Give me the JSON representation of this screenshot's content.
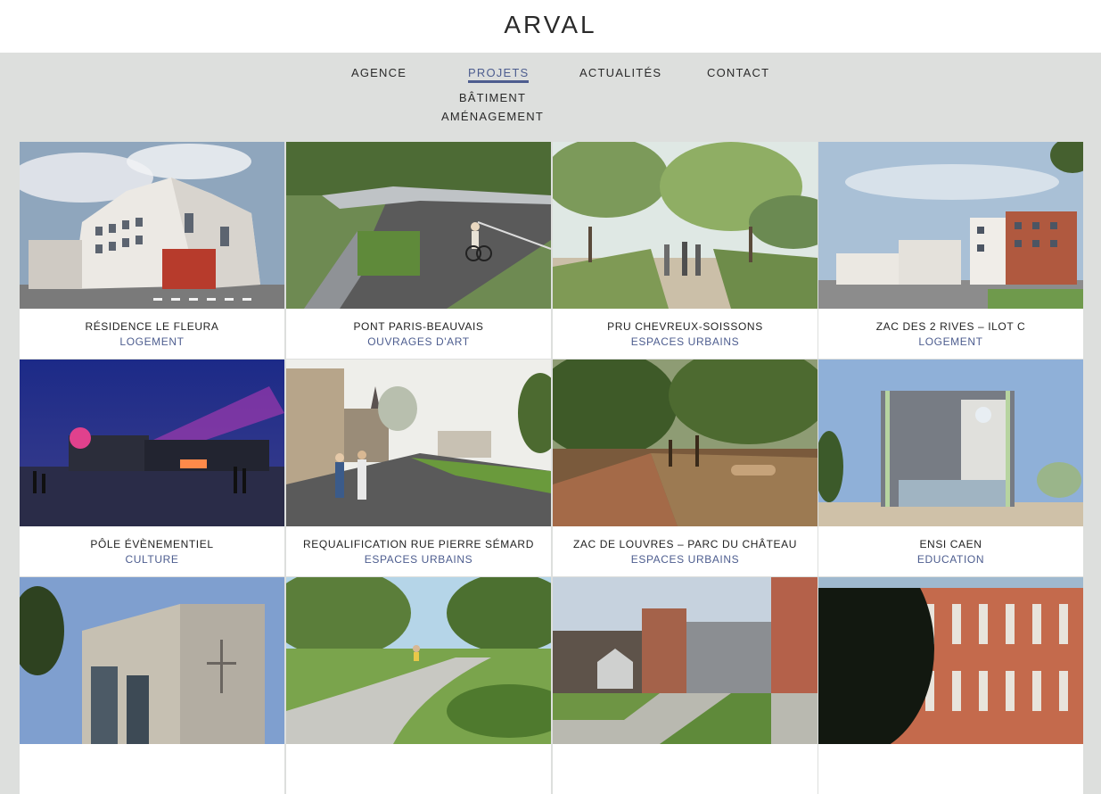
{
  "brand": {
    "logo": "ARVAL"
  },
  "nav": {
    "items": [
      {
        "label": "AGENCE"
      },
      {
        "label": "PROJETS"
      },
      {
        "label": "ACTUALITÉS"
      },
      {
        "label": "CONTACT"
      }
    ],
    "sub_items": [
      {
        "label": "BÂTIMENT"
      },
      {
        "label": "AMÉNAGEMENT"
      }
    ]
  },
  "projects": [
    {
      "title": "RÉSIDENCE LE FLEURA",
      "category": "LOGEMENT"
    },
    {
      "title": "PONT PARIS-BEAUVAIS",
      "category": "OUVRAGES D'ART"
    },
    {
      "title": "PRU CHEVREUX-SOISSONS",
      "category": "ESPACES URBAINS"
    },
    {
      "title": "ZAC DES 2 RIVES – ILOT C",
      "category": "LOGEMENT"
    },
    {
      "title": "PÔLE ÉVÈNEMENTIEL",
      "category": "CULTURE"
    },
    {
      "title": "REQUALIFICATION RUE PIERRE SÉMARD",
      "category": "ESPACES URBAINS"
    },
    {
      "title": "ZAC DE LOUVRES – PARC DU CHÂTEAU",
      "category": "ESPACES URBAINS"
    },
    {
      "title": "ENSI CAEN",
      "category": "EDUCATION"
    }
  ],
  "colors": {
    "accent": "#4d5d8f",
    "page_bg": "#dddfdd",
    "header_bg": "#ffffff"
  }
}
